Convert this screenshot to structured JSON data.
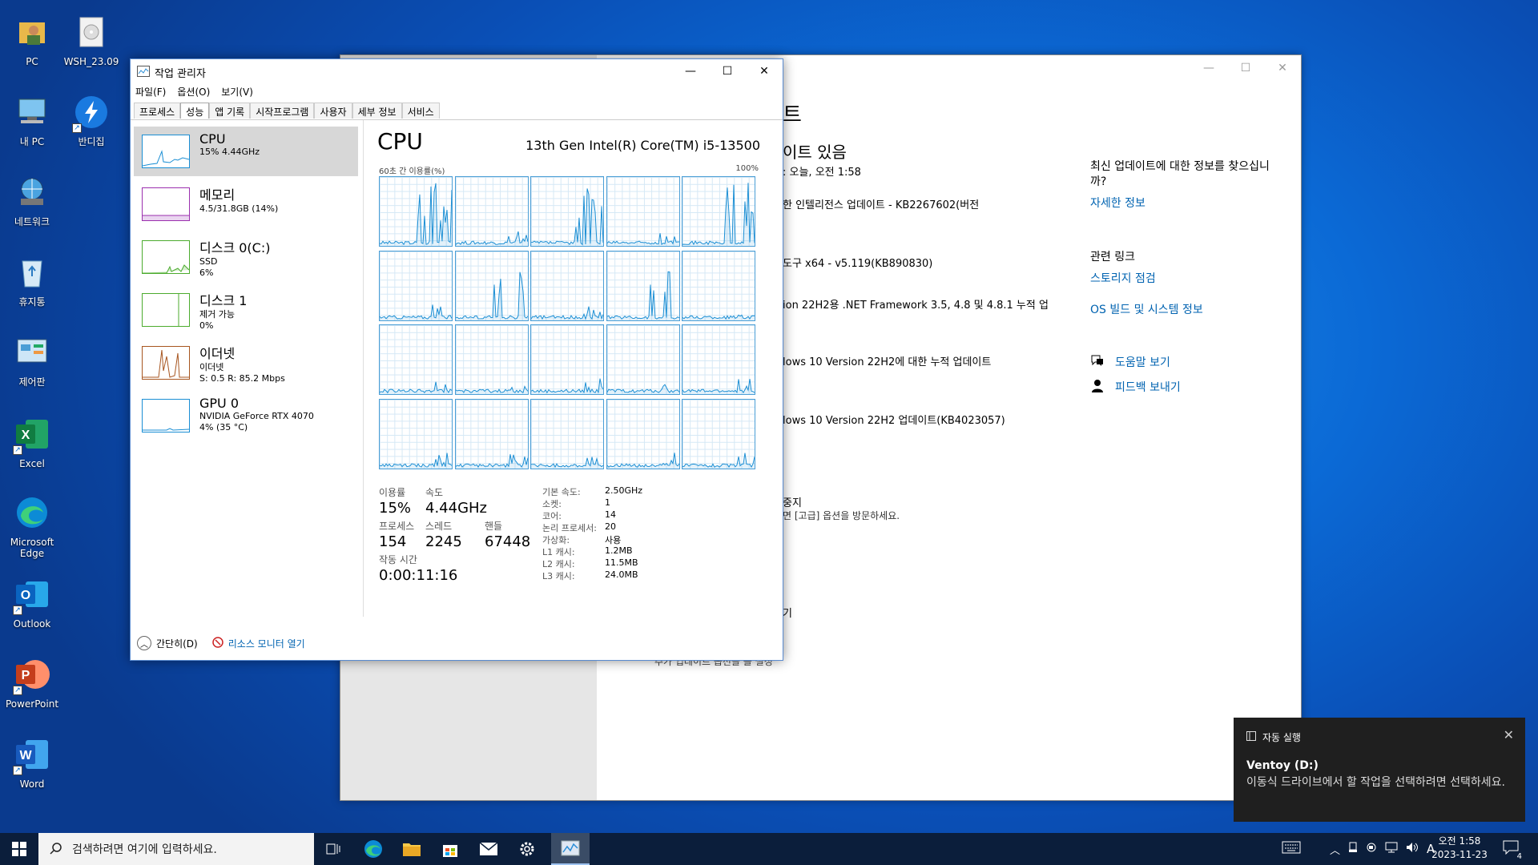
{
  "desktop": {
    "icons": [
      {
        "label": "PC",
        "icon": "user-folder-icon"
      },
      {
        "label": "WSH_23.09",
        "icon": "cd-icon"
      },
      {
        "label": "내 PC",
        "icon": "computer-icon"
      },
      {
        "label": "반디집",
        "icon": "bandizip-icon"
      },
      {
        "label": "네트워크",
        "icon": "network-icon"
      },
      {
        "label": "휴지통",
        "icon": "recycle-bin-icon"
      },
      {
        "label": "제어판",
        "icon": "control-panel-icon"
      },
      {
        "label": "Excel",
        "icon": "excel-icon"
      },
      {
        "label": "Microsoft Edge",
        "icon": "edge-icon"
      },
      {
        "label": "Outlook",
        "icon": "outlook-icon"
      },
      {
        "label": "PowerPoint",
        "icon": "powerpoint-icon"
      },
      {
        "label": "Word",
        "icon": "word-icon"
      }
    ]
  },
  "settings_window": {
    "title_fragment": "트",
    "status_fragment": "이트 있음",
    "last_check": ": 오늘, 오전 1:58",
    "updates": [
      "한 인텔리전스 업데이트 - KB2267602(버전",
      "도구 x64 - v5.119(KB890830)",
      "ion 22H2용 .NET Framework 3.5, 4.8 및 4.8.1 누적 업",
      "lows 10 Version 22H2에 대한 누적 업데이트",
      "lows 10 Version 22H2 업데이트(KB4023057)"
    ],
    "pause_fragment": "중지",
    "advanced_fragment": "면 [고급] 옵션을 방문하세요.",
    "fragment_g": "기",
    "fragment_last": "추가 업데이트 옵션을 볼 설정",
    "info_q": "최신 업데이트에 대한 정보를 찾으십니까?",
    "learn_more": "자세한 정보",
    "related_links": "관련 링크",
    "storage_check": "스토리지 점검",
    "os_build": "OS 빌드 및 시스템 정보",
    "get_help": "도움말 보기",
    "feedback": "피드백 보내기"
  },
  "task_manager": {
    "title": "작업 관리자",
    "menu": [
      "파일(F)",
      "옵션(O)",
      "보기(V)"
    ],
    "tabs": [
      "프로세스",
      "성능",
      "앱 기록",
      "시작프로그램",
      "사용자",
      "세부 정보",
      "서비스"
    ],
    "active_tab": "성능",
    "sidebar": [
      {
        "name": "CPU",
        "line1": "15% 4.44GHz",
        "line2": "",
        "color": "#1a8ed4"
      },
      {
        "name": "메모리",
        "line1": "4.5/31.8GB (14%)",
        "line2": "",
        "color": "#9b2fae"
      },
      {
        "name": "디스크 0(C:)",
        "line1": "SSD",
        "line2": "6%",
        "color": "#4cab2e"
      },
      {
        "name": "디스크 1",
        "line1": "제거 가능",
        "line2": "0%",
        "color": "#4cab2e"
      },
      {
        "name": "이더넷",
        "line1": "이더넷",
        "line2": "S: 0.5 R: 85.2 Mbps",
        "color": "#a7551f"
      },
      {
        "name": "GPU 0",
        "line1": "NVIDIA GeForce RTX 4070",
        "line2": "4% (35 °C)",
        "color": "#1a8ed4"
      }
    ],
    "cpu": {
      "heading": "CPU",
      "model": "13th Gen Intel(R) Core(TM) i5-13500",
      "graph_label": "60초 간 이용률(%)",
      "graph_max": "100%",
      "utilization_label": "이용률",
      "utilization": "15%",
      "speed_label": "속도",
      "speed": "4.44GHz",
      "processes_label": "프로세스",
      "processes": "154",
      "threads_label": "스레드",
      "threads": "2245",
      "handles_label": "핸들",
      "handles": "67448",
      "uptime_label": "작동 시간",
      "uptime": "0:00:11:16",
      "specs": [
        {
          "k": "기본 속도:",
          "v": "2.50GHz"
        },
        {
          "k": "소켓:",
          "v": "1"
        },
        {
          "k": "코어:",
          "v": "14"
        },
        {
          "k": "논리 프로세서:",
          "v": "20"
        },
        {
          "k": "가상화:",
          "v": "사용"
        },
        {
          "k": "L1 캐시:",
          "v": "1.2MB"
        },
        {
          "k": "L2 캐시:",
          "v": "11.5MB"
        },
        {
          "k": "L3 캐시:",
          "v": "24.0MB"
        }
      ]
    },
    "footer_collapse": "간단히(D)",
    "footer_resmon": "리소스 모니터 열기"
  },
  "notification": {
    "app": "자동 실행",
    "title": "Ventoy (D:)",
    "body": "이동식 드라이브에서 할 작업을 선택하려면 선택하세요."
  },
  "taskbar": {
    "search_placeholder": "검색하려면 여기에 입력하세요.",
    "clock_time": "오전 1:58",
    "clock_date": "2023-11-23",
    "ime": "A",
    "notif_count": "4"
  }
}
